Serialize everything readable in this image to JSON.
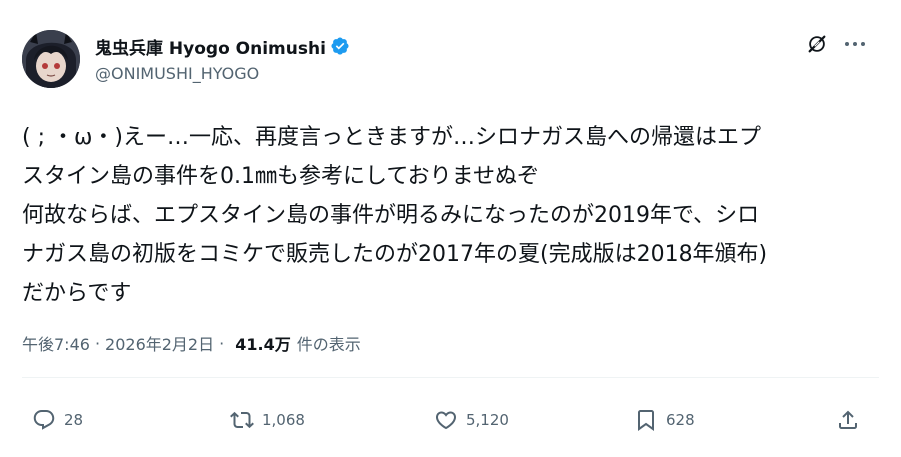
{
  "author": {
    "display_name": "鬼虫兵庫 Hyogo Onimushi",
    "handle": "@ONIMUSHI_HYOGO",
    "verified": true,
    "verified_color": "#1d9bf0"
  },
  "header_icons": [
    "grok-icon",
    "more-icon"
  ],
  "tweet": {
    "lines": [
      "( ; ・ω・)えー…一応、再度言っときますが…シロナガス島への帰還はエプ",
      "スタイン島の事件を0.1㎜も参考にしておりませぬぞ",
      "何故ならば、エプスタイン島の事件が明るみになったのが2019年で、シロ",
      "ナガス島の初版をコミケで販売したのが2017年の夏(完成版は2018年頒布)",
      "だからです"
    ]
  },
  "meta": {
    "time": "午後7:46",
    "separator": "·",
    "date": "2026年2月2日",
    "views": "41.4万",
    "views_label": "件の表示"
  },
  "actions": {
    "replies": "28",
    "reposts": "1,068",
    "likes": "5,120",
    "bookmarks": "628"
  },
  "colors": {
    "text": "#0f1419",
    "secondary": "#536471",
    "divider": "#eff3f4"
  }
}
